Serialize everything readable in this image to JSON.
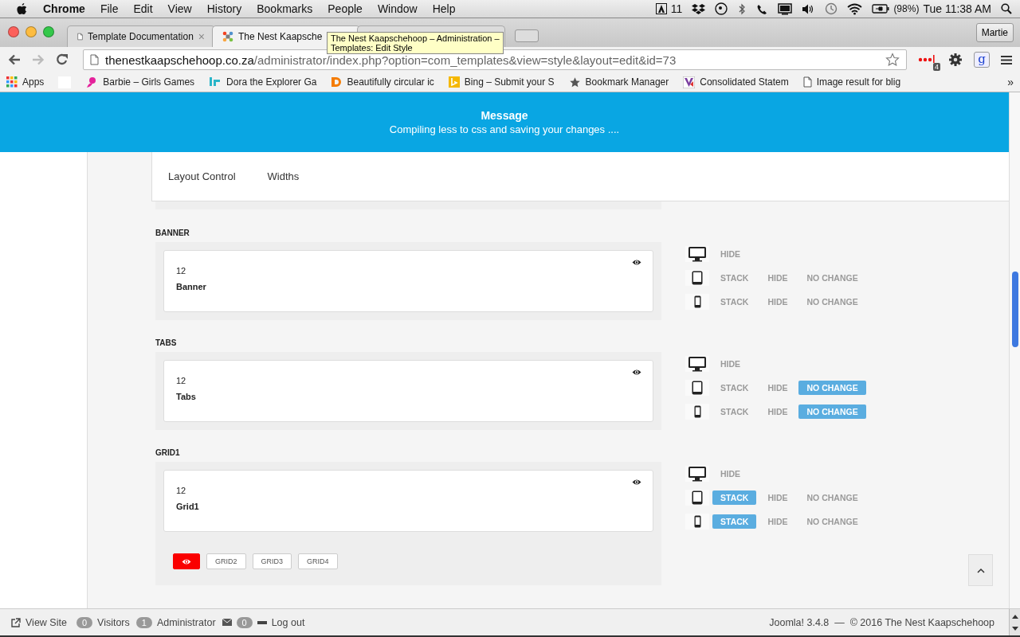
{
  "menubar": {
    "app": "Chrome",
    "menus": [
      "File",
      "Edit",
      "View",
      "History",
      "Bookmarks",
      "People",
      "Window",
      "Help"
    ],
    "status": {
      "count": "11",
      "battery": "(98%)",
      "clock": "Tue 11:38 AM"
    }
  },
  "tabs": [
    {
      "title": "Template Documentation",
      "close": "×",
      "kind": "page",
      "selected": false
    },
    {
      "title": "The Nest Kaapsche",
      "kind": "joomla",
      "selected": true
    },
    {
      "kind": "joomla",
      "selected": false
    }
  ],
  "profile": "Martie",
  "tooltip": [
    "The Nest Kaapschehoop – Administration –",
    "Templates: Edit Style"
  ],
  "address": {
    "domain": "thenestkaapschehoop.co.za",
    "path": "/administrator/index.php?option=com_templates&view=style&layout=edit&id=73"
  },
  "extensions": {
    "badge": "4",
    "google": "g"
  },
  "bookmarks": [
    {
      "label": "Apps",
      "kind": "apps"
    },
    {
      "kind": "blank"
    },
    {
      "label": "Barbie – Girls Games",
      "kind": "barbie"
    },
    {
      "label": "Dora the Explorer Ga",
      "kind": "jr"
    },
    {
      "label": "Beautifully circular ic",
      "kind": "d"
    },
    {
      "label": "Bing – Submit your S",
      "kind": "bing"
    },
    {
      "label": "Bookmark Manager",
      "kind": "star"
    },
    {
      "label": "Consolidated Statem",
      "kind": "shield"
    },
    {
      "label": "Image result for blig",
      "kind": "page"
    }
  ],
  "bookmarks_more": "»",
  "message": {
    "title": "Message",
    "text": "Compiling less to css and saving your changes ...."
  },
  "layout_tabs": [
    "Layout Control",
    "Widths"
  ],
  "sections": [
    {
      "label": "BANNER",
      "size": "12",
      "name": "Banner",
      "devices": [
        {
          "kind": "desktop",
          "options": [
            {
              "label": "HIDE",
              "selected": false
            }
          ]
        },
        {
          "kind": "tablet",
          "options": [
            {
              "label": "STACK",
              "selected": false
            },
            {
              "label": "HIDE",
              "selected": false
            },
            {
              "label": "NO CHANGE",
              "selected": false
            }
          ]
        },
        {
          "kind": "phone",
          "options": [
            {
              "label": "STACK",
              "selected": false
            },
            {
              "label": "HIDE",
              "selected": false
            },
            {
              "label": "NO CHANGE",
              "selected": false
            }
          ]
        }
      ]
    },
    {
      "label": "TABS",
      "size": "12",
      "name": "Tabs",
      "devices": [
        {
          "kind": "desktop",
          "options": [
            {
              "label": "HIDE",
              "selected": false
            }
          ]
        },
        {
          "kind": "tablet",
          "options": [
            {
              "label": "STACK",
              "selected": false
            },
            {
              "label": "HIDE",
              "selected": false
            },
            {
              "label": "NO CHANGE",
              "selected": true
            }
          ]
        },
        {
          "kind": "phone",
          "options": [
            {
              "label": "STACK",
              "selected": false
            },
            {
              "label": "HIDE",
              "selected": false
            },
            {
              "label": "NO CHANGE",
              "selected": true
            }
          ]
        }
      ]
    },
    {
      "label": "GRID1",
      "size": "12",
      "name": "Grid1",
      "devices": [
        {
          "kind": "desktop",
          "options": [
            {
              "label": "HIDE",
              "selected": false
            }
          ]
        },
        {
          "kind": "tablet",
          "options": [
            {
              "label": "STACK",
              "selected": true
            },
            {
              "label": "HIDE",
              "selected": false
            },
            {
              "label": "NO CHANGE",
              "selected": false
            }
          ]
        },
        {
          "kind": "phone",
          "options": [
            {
              "label": "STACK",
              "selected": true
            },
            {
              "label": "HIDE",
              "selected": false
            },
            {
              "label": "NO CHANGE",
              "selected": false
            }
          ]
        }
      ],
      "grid_buttons": [
        {
          "kind": "eye",
          "selected": true
        },
        {
          "kind": "text",
          "label": "GRID2",
          "selected": false
        },
        {
          "kind": "text",
          "label": "GRID3",
          "selected": false
        },
        {
          "kind": "text",
          "label": "GRID4",
          "selected": false
        }
      ]
    }
  ],
  "footer": {
    "view_site": "View Site",
    "visitors_count": "0",
    "visitors": "Visitors",
    "admins_count": "1",
    "admins": "Administrator",
    "messages_count": "0",
    "logout": "Log out",
    "credit": "Joomla! 3.4.8  —  © 2016 The Nest Kaapschehoop"
  }
}
